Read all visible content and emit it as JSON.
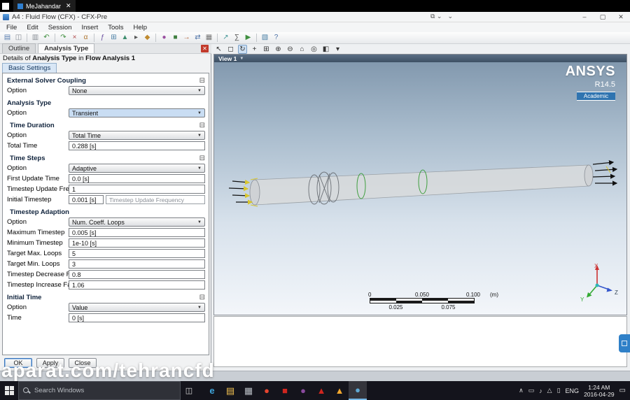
{
  "browser": {
    "tab_title": "MeJahandar"
  },
  "window": {
    "title": "A4 : Fluid Flow (CFX) - CFX-Pre",
    "controls": {
      "minimize": "–",
      "maximize": "▢",
      "close": "✕"
    }
  },
  "menu": {
    "items": [
      "File",
      "Edit",
      "Session",
      "Insert",
      "Tools",
      "Help"
    ]
  },
  "main_toolbar": {
    "icons": [
      {
        "name": "save-icon",
        "glyph": "▤",
        "color": "#5b7fb0"
      },
      {
        "name": "copy-icon",
        "glyph": "◫",
        "color": "#8a8f96"
      },
      {
        "name": "paste-icon",
        "glyph": "▥",
        "color": "#8a8f96"
      },
      {
        "name": "undo-icon",
        "glyph": "↶",
        "color": "#3f8f3f"
      },
      {
        "name": "redo-icon",
        "glyph": "↷",
        "color": "#3f8f3f"
      },
      {
        "name": "delete-icon",
        "glyph": "×",
        "color": "#b04a4a"
      },
      {
        "name": "expression-icon",
        "glyph": "α",
        "color": "#b0762f"
      },
      {
        "name": "variable-icon",
        "glyph": "ƒ",
        "color": "#6a4fa0"
      },
      {
        "name": "table-icon",
        "glyph": "⊞",
        "color": "#4a7fa5"
      },
      {
        "name": "chart-icon",
        "glyph": "▲",
        "color": "#3f8f6f"
      },
      {
        "name": "command-editor-icon",
        "glyph": "▸",
        "color": "#555555"
      },
      {
        "name": "material-icon",
        "glyph": "◆",
        "color": "#c08a2f"
      },
      {
        "name": "reaction-icon",
        "glyph": "●",
        "color": "#9a4fa0"
      },
      {
        "name": "domain-icon",
        "glyph": "■",
        "color": "#3f7f3f"
      },
      {
        "name": "boundary-icon",
        "glyph": "→",
        "color": "#b05a2f"
      },
      {
        "name": "interface-icon",
        "glyph": "⇄",
        "color": "#4a6fa5"
      },
      {
        "name": "mesh-adaption-icon",
        "glyph": "▦",
        "color": "#777777"
      },
      {
        "name": "initialisation-icon",
        "glyph": "↗",
        "color": "#4a9a9a"
      },
      {
        "name": "solver-control-icon",
        "glyph": "∑",
        "color": "#555555"
      },
      {
        "name": "run-icon",
        "glyph": "▶",
        "color": "#3f8f3f"
      },
      {
        "name": "monitor-icon",
        "glyph": "▧",
        "color": "#4a7fa5"
      },
      {
        "name": "help-icon",
        "glyph": "?",
        "color": "#4a6fa5"
      }
    ]
  },
  "left_panel": {
    "tabs": [
      {
        "label": "Outline"
      },
      {
        "label": "Analysis Type"
      }
    ],
    "details": {
      "prefix": "Details of ",
      "subject": "Analysis Type",
      "mid": " in ",
      "target": "Flow Analysis 1"
    },
    "basic_settings_label": "Basic Settings",
    "rows": [
      {
        "type": "group",
        "label": "External Solver Coupling",
        "toggle": true
      },
      {
        "type": "select",
        "label": "Option",
        "value": "None"
      },
      {
        "type": "group",
        "label": "Analysis Type",
        "toggle": false
      },
      {
        "type": "select",
        "label": "Option",
        "value": "Transient",
        "highlight": true
      },
      {
        "type": "group",
        "label": "Time Duration",
        "toggle": true,
        "sub": true
      },
      {
        "type": "select",
        "label": "Option",
        "value": "Total Time"
      },
      {
        "type": "input",
        "label": "Total Time",
        "value": "0.288 [s]"
      },
      {
        "type": "group",
        "label": "Time Steps",
        "toggle": true,
        "sub": true
      },
      {
        "type": "select",
        "label": "Option",
        "value": "Adaptive"
      },
      {
        "type": "input",
        "label": "First Update Time",
        "value": "0.0 [s]"
      },
      {
        "type": "input",
        "label": "Timestep Update Freq.",
        "value": "1"
      },
      {
        "type": "input",
        "label": "Initial Timestep",
        "value": "0.001 [s]",
        "tooltip": "Timestep Update Frequency"
      },
      {
        "type": "group",
        "label": "Timestep Adaption",
        "toggle": false,
        "sub": true
      },
      {
        "type": "select",
        "label": "Option",
        "value": "Num. Coeff. Loops"
      },
      {
        "type": "input",
        "label": "Maximum Timestep",
        "value": "0.005 [s]"
      },
      {
        "type": "input",
        "label": "Minimum Timestep",
        "value": "1e-10 [s]"
      },
      {
        "type": "input",
        "label": "Target Max. Loops",
        "value": "5"
      },
      {
        "type": "input",
        "label": "Target Min. Loops",
        "value": "3"
      },
      {
        "type": "input",
        "label": "Timestep Decrease Fac",
        "value": "0.8"
      },
      {
        "type": "input",
        "label": "Timestep Increase Fac.",
        "value": "1.06"
      },
      {
        "type": "group",
        "label": "Initial Time",
        "toggle": true
      },
      {
        "type": "select",
        "label": "Option",
        "value": "Value"
      },
      {
        "type": "input",
        "label": "Time",
        "value": "0 [s]"
      }
    ],
    "buttons": [
      "OK",
      "Apply",
      "Close"
    ]
  },
  "viewport": {
    "toolbar_icons": [
      {
        "name": "select-icon",
        "glyph": "↖"
      },
      {
        "name": "box-select-icon",
        "glyph": "◻"
      },
      {
        "name": "rotate-icon",
        "glyph": "↻",
        "active": true
      },
      {
        "name": "pan-icon",
        "glyph": "+"
      },
      {
        "name": "zoom-box-icon",
        "glyph": "⊞"
      },
      {
        "name": "zoom-in-icon",
        "glyph": "⊕"
      },
      {
        "name": "zoom-out-icon",
        "glyph": "⊖"
      },
      {
        "name": "fit-view-icon",
        "glyph": "⌂"
      },
      {
        "name": "center-view-icon",
        "glyph": "◎"
      },
      {
        "name": "render-options-icon",
        "glyph": "◧"
      },
      {
        "name": "view-menu-icon",
        "glyph": "▾"
      }
    ],
    "view_tab_label": "View 1",
    "ansys": {
      "brand": "ANSYS",
      "version": "R14.5",
      "edition": "Academic"
    },
    "scalebar": {
      "top_labels": [
        "0",
        "0.050",
        "0.100"
      ],
      "unit": "(m)",
      "bottom_labels": [
        "0.025",
        "0.075"
      ]
    },
    "triad": {
      "x": "X",
      "y": "Y",
      "z": "Z"
    }
  },
  "watermark": {
    "text": "aparat.com/tehrancfd"
  },
  "taskbar": {
    "search_placeholder": "Search Windows",
    "apps": [
      {
        "name": "edge-icon",
        "glyph": "e",
        "color": "#3fa6dd"
      },
      {
        "name": "file-explorer-icon",
        "glyph": "▤",
        "color": "#f3c351"
      },
      {
        "name": "store-icon",
        "glyph": "▦",
        "color": "#b9bec4"
      },
      {
        "name": "browser-red-icon",
        "glyph": "●",
        "color": "#e6452f"
      },
      {
        "name": "pdf-icon",
        "glyph": "■",
        "color": "#d0261f"
      },
      {
        "name": "media-app-icon",
        "glyph": "●",
        "color": "#8a4a9e"
      },
      {
        "name": "acrobat-icon",
        "glyph": "▲",
        "color": "#d0261f"
      },
      {
        "name": "flame-app-icon",
        "glyph": "▲",
        "color": "#f2a72e"
      },
      {
        "name": "cfx-app-icon",
        "glyph": "●",
        "color": "#5fa8d3",
        "active": true
      }
    ],
    "tray_icons": [
      {
        "name": "chevron-up-icon",
        "glyph": "∧"
      },
      {
        "name": "display-icon",
        "glyph": "▭"
      },
      {
        "name": "volume-icon",
        "glyph": "♪"
      },
      {
        "name": "network-icon",
        "glyph": "△"
      },
      {
        "name": "battery-icon",
        "glyph": "▯"
      }
    ],
    "language": "ENG",
    "time": "1:24 AM",
    "date": "2016-04-29"
  }
}
